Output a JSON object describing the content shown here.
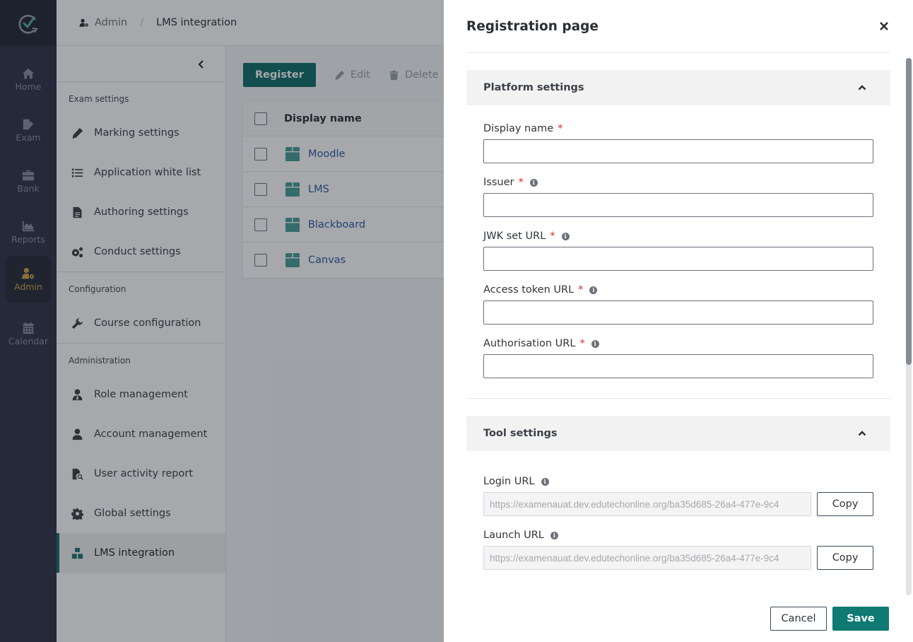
{
  "rail": {
    "logo": "app-logo",
    "items": [
      {
        "label": "Home",
        "icon": "home-icon"
      },
      {
        "label": "Exam",
        "icon": "exam-icon"
      },
      {
        "label": "Bank",
        "icon": "bank-icon"
      },
      {
        "label": "Reports",
        "icon": "reports-icon"
      },
      {
        "label": "Admin",
        "icon": "admin-icon",
        "active": true
      },
      {
        "label": "Calendar",
        "icon": "calendar-icon"
      }
    ],
    "active_color": "#d1a54a"
  },
  "breadcrumb": {
    "parent": "Admin",
    "separator": "/",
    "current": "LMS integration"
  },
  "subnav": {
    "sections": [
      {
        "title": "Exam settings",
        "items": [
          {
            "label": "Marking settings",
            "icon": "pen-icon"
          },
          {
            "label": "Application white list",
            "icon": "list-icon"
          },
          {
            "label": "Authoring settings",
            "icon": "file-icon"
          },
          {
            "label": "Conduct settings",
            "icon": "cogs-icon"
          }
        ]
      },
      {
        "title": "Configuration",
        "items": [
          {
            "label": "Course configuration",
            "icon": "wrench-icon"
          }
        ]
      },
      {
        "title": "Administration",
        "items": [
          {
            "label": "Role management",
            "icon": "user-tie-icon"
          },
          {
            "label": "Account management",
            "icon": "user-icon"
          },
          {
            "label": "User activity report",
            "icon": "file-search-icon"
          },
          {
            "label": "Global settings",
            "icon": "gear-icon"
          },
          {
            "label": "LMS integration",
            "icon": "boxes-icon",
            "active": true
          }
        ]
      }
    ],
    "accent": "#0f6e68"
  },
  "toolbar": {
    "register_label": "Register",
    "edit_label": "Edit",
    "delete_label": "Delete"
  },
  "table": {
    "header": "Display name",
    "rows": [
      "Moodle",
      "LMS",
      "Blackboard",
      "Canvas"
    ]
  },
  "drawer": {
    "title": "Registration page",
    "platform": {
      "title": "Platform settings",
      "fields": [
        {
          "label": "Display name",
          "required": true,
          "info": false,
          "value": ""
        },
        {
          "label": "Issuer",
          "required": true,
          "info": true,
          "value": ""
        },
        {
          "label": "JWK set URL",
          "required": true,
          "info": true,
          "value": ""
        },
        {
          "label": "Access token URL",
          "required": true,
          "info": true,
          "value": ""
        },
        {
          "label": "Authorisation URL",
          "required": true,
          "info": true,
          "value": ""
        }
      ]
    },
    "tool": {
      "title": "Tool settings",
      "fields": [
        {
          "label": "Login URL",
          "value": "https://examenauat.dev.edutechonline.org/ba35d685-26a4-477e-9c4",
          "copy_label": "Copy"
        },
        {
          "label": "Launch URL",
          "value": "https://examenauat.dev.edutechonline.org/ba35d685-26a4-477e-9c4",
          "copy_label": "Copy"
        }
      ]
    },
    "required_mark": "*",
    "info_glyph": "i",
    "cancel_label": "Cancel",
    "save_label": "Save",
    "save_color": "#0f7a71"
  }
}
